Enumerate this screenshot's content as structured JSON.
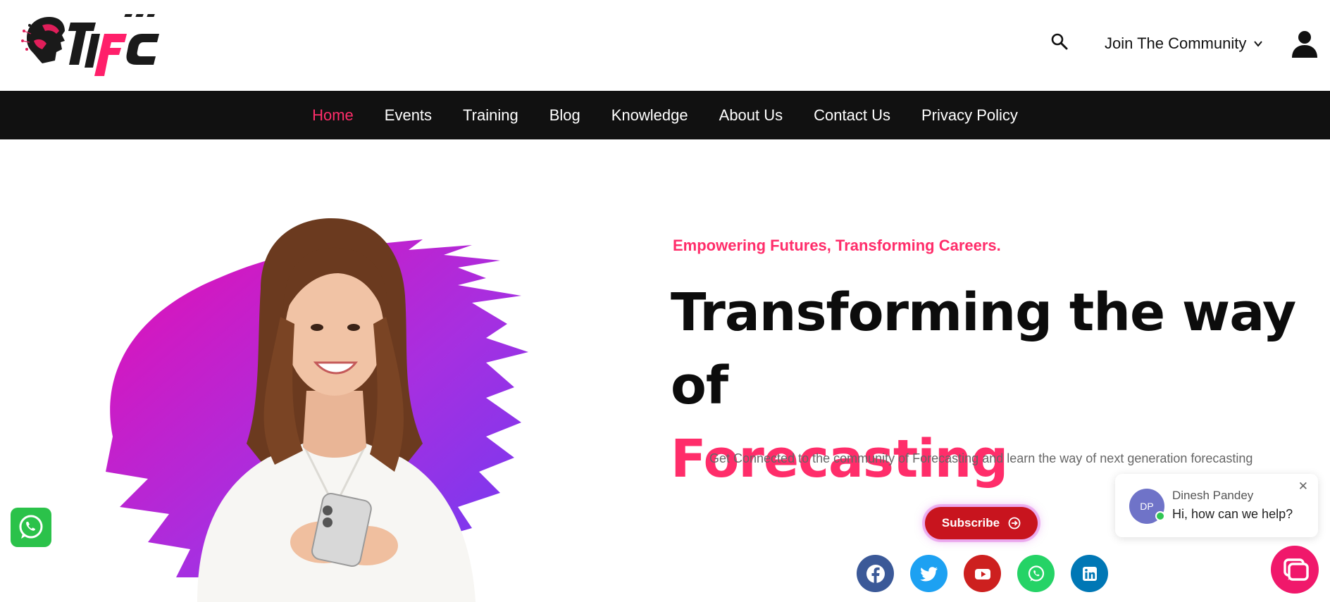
{
  "header": {
    "logo_alt": "IIFC",
    "join_label": "Join The Community"
  },
  "nav": {
    "items": [
      {
        "label": "Home",
        "active": true
      },
      {
        "label": "Events"
      },
      {
        "label": "Training"
      },
      {
        "label": "Blog"
      },
      {
        "label": "Knowledge"
      },
      {
        "label": "About Us"
      },
      {
        "label": "Contact Us"
      },
      {
        "label": "Privacy Policy"
      }
    ]
  },
  "hero": {
    "tagline": "Empowering Futures, Transforming Careers.",
    "headline_line1": "Transforming the way of",
    "headline_line2": "Forecasting",
    "subtext": "Get Connected to the community of Forecasting and learn the way of next generation forecasting",
    "subscribe_label": "Subscribe"
  },
  "socials": [
    {
      "name": "facebook-icon",
      "color": "#3b5998"
    },
    {
      "name": "twitter-icon",
      "color": "#1da1f2"
    },
    {
      "name": "youtube-icon",
      "color": "#cd201f"
    },
    {
      "name": "whatsapp-icon",
      "color": "#25d366"
    },
    {
      "name": "linkedin-icon",
      "color": "#0077b5"
    }
  ],
  "chat": {
    "avatar_initials": "DP",
    "agent_name": "Dinesh Pandey",
    "message": "Hi, how can we help?",
    "close_symbol": "✕"
  },
  "colors": {
    "accent": "#ff2d6a",
    "nav_bg": "#111111",
    "subscribe_bg": "#c8141e"
  }
}
